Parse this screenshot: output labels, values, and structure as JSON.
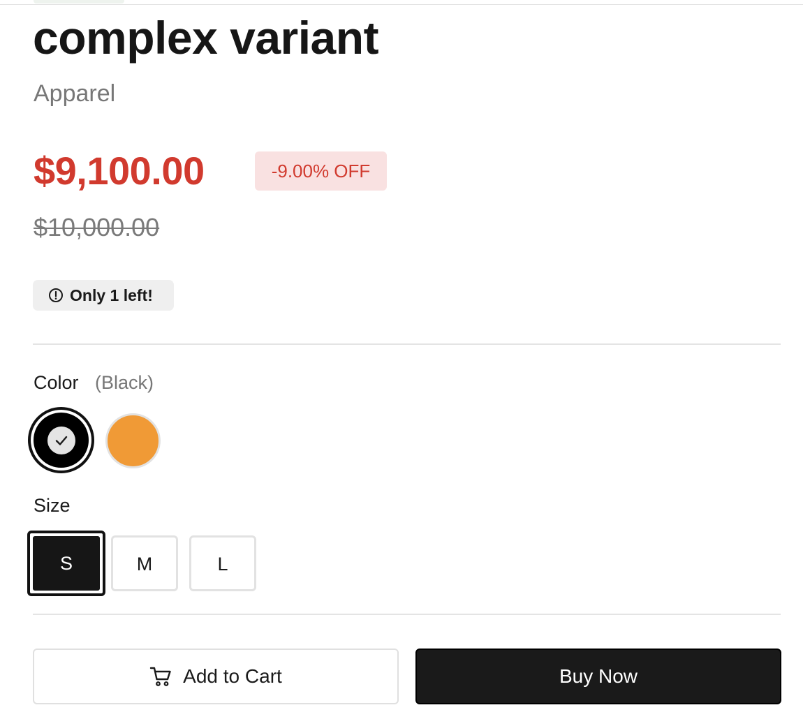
{
  "product": {
    "title": "complex variant",
    "category": "Apparel"
  },
  "pricing": {
    "current_price": "$9,100.00",
    "discount_label": "-9.00% OFF",
    "original_price": "$10,000.00",
    "sale_color": "#d13a2e"
  },
  "stock": {
    "icon": "alert-circle-icon",
    "message": "Only 1 left!"
  },
  "options": {
    "color": {
      "label": "Color",
      "selected_display": "(Black)",
      "swatches": [
        {
          "name": "Black",
          "hex": "#000000",
          "selected": true
        },
        {
          "name": "Orange",
          "hex": "#f09a36",
          "selected": false
        }
      ]
    },
    "size": {
      "label": "Size",
      "values": [
        {
          "label": "S",
          "selected": true
        },
        {
          "label": "M",
          "selected": false
        },
        {
          "label": "L",
          "selected": false
        }
      ]
    }
  },
  "actions": {
    "add_to_cart_label": "Add to Cart",
    "add_to_cart_icon": "cart-icon",
    "buy_now_label": "Buy Now"
  }
}
